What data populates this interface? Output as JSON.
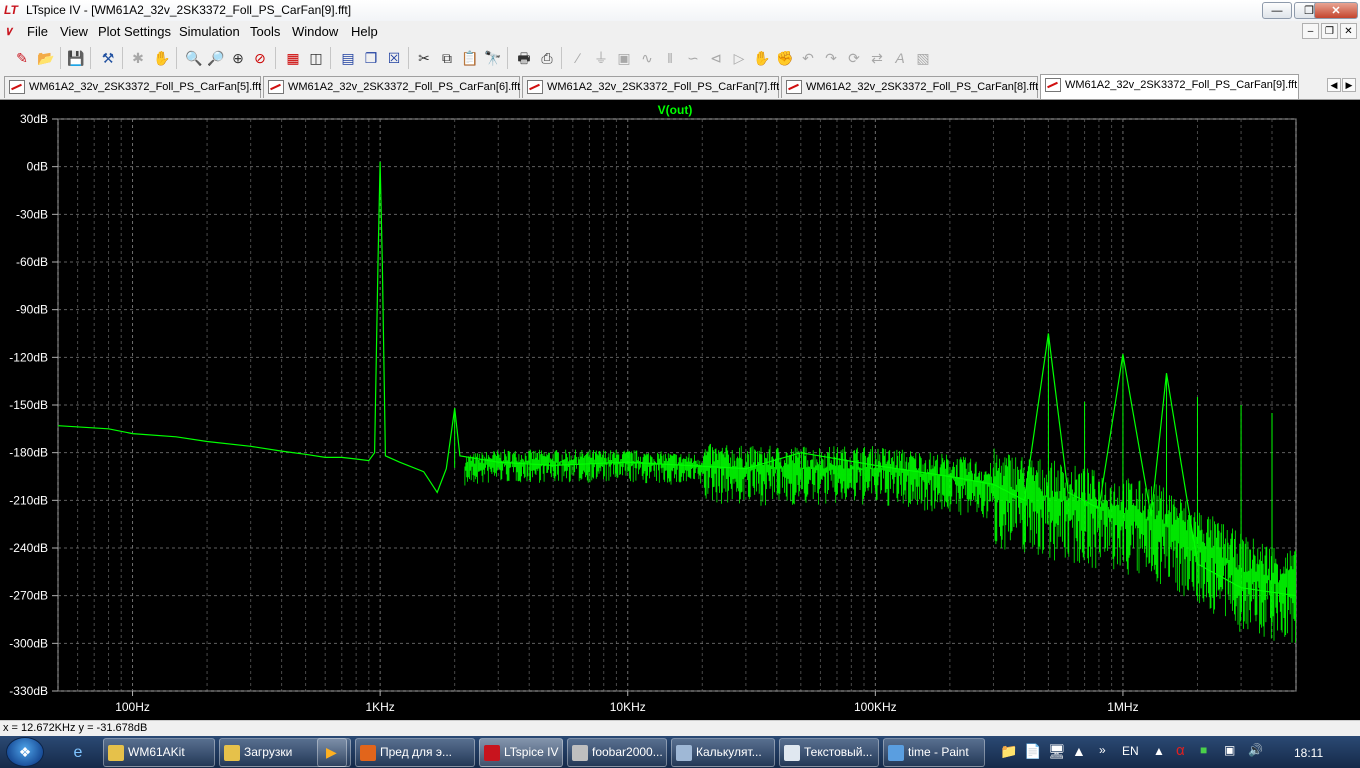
{
  "window": {
    "app_icon": "LT",
    "title": "LTspice IV - [WM61A2_32v_2SK3372_Foll_PS_CarFan[9].fft]",
    "buttons": [
      "minimize-icon",
      "restore-icon",
      "close-icon"
    ]
  },
  "menu": {
    "items": [
      "File",
      "View",
      "Plot Settings",
      "Simulation",
      "Tools",
      "Window",
      "Help"
    ]
  },
  "toolbar": {
    "icons": [
      "new-schematic-icon",
      "open-icon",
      "save-icon",
      "hammer-icon",
      "run-icon",
      "halt-icon",
      "zoom-in-icon",
      "zoom-out-icon",
      "zoom-fit-icon",
      "zoom-cancel-icon",
      "autorange-icon",
      "pick-visible-traces-icon",
      "tile-horizontal-icon",
      "cascade-icon",
      "close-all-icon",
      "cut-icon",
      "copy-icon",
      "paste-icon",
      "find-icon",
      "print-preview-icon",
      "print-icon",
      "wire-icon",
      "ground-icon",
      "label-icon",
      "resistor-icon",
      "capacitor-icon",
      "inductor-icon",
      "diode-icon",
      "component-icon",
      "move-icon",
      "drag-icon",
      "undo-icon",
      "redo-icon",
      "rotate-icon",
      "mirror-icon",
      "text-icon",
      "spice-directive-icon"
    ]
  },
  "tabs": [
    {
      "label": "WM61A2_32v_2SK3372_Foll_PS_CarFan[5].fft",
      "active": false
    },
    {
      "label": "WM61A2_32v_2SK3372_Foll_PS_CarFan[6].fft",
      "active": false
    },
    {
      "label": "WM61A2_32v_2SK3372_Foll_PS_CarFan[7].fft",
      "active": false
    },
    {
      "label": "WM61A2_32v_2SK3372_Foll_PS_CarFan[8].fft",
      "active": false
    },
    {
      "label": "WM61A2_32v_2SK3372_Foll_PS_CarFan[9].fft",
      "active": true
    }
  ],
  "chart_data": {
    "type": "line",
    "title": "",
    "xlabel": "",
    "ylabel": "",
    "x_scale": "log",
    "xlim": [
      50,
      5000000
    ],
    "ylim": [
      -330,
      30
    ],
    "grid": true,
    "grid_style": "dashed",
    "x_tick_labels": [
      "100Hz",
      "1KHz",
      "10KHz",
      "100KHz",
      "1MHz"
    ],
    "x_ticks": [
      100,
      1000,
      10000,
      100000,
      1000000
    ],
    "y_ticks": [
      30,
      0,
      -30,
      -60,
      -90,
      -120,
      -150,
      -180,
      -210,
      -240,
      -270,
      -300,
      -330
    ],
    "y_tick_labels": [
      "30dB",
      "0dB",
      "-30dB",
      "-60dB",
      "-90dB",
      "-120dB",
      "-150dB",
      "-180dB",
      "-210dB",
      "-240dB",
      "-270dB",
      "-300dB",
      "-330dB"
    ],
    "series": [
      {
        "name": "V(out)",
        "color": "#00ff00",
        "points": [
          [
            50,
            -163
          ],
          [
            80,
            -165
          ],
          [
            100,
            -168
          ],
          [
            150,
            -170
          ],
          [
            200,
            -173
          ],
          [
            300,
            -176
          ],
          [
            400,
            -179
          ],
          [
            500,
            -181
          ],
          [
            600,
            -183
          ],
          [
            700,
            -183
          ],
          [
            800,
            -184
          ],
          [
            900,
            -185
          ],
          [
            950,
            -180
          ],
          [
            980,
            -60
          ],
          [
            1000,
            3
          ],
          [
            1020,
            -60
          ],
          [
            1050,
            -182
          ],
          [
            1200,
            -186
          ],
          [
            1500,
            -192
          ],
          [
            1700,
            -205
          ],
          [
            1850,
            -190
          ],
          [
            2000,
            -152
          ],
          [
            2100,
            -182
          ],
          [
            3000,
            -186
          ],
          [
            5000,
            -188
          ],
          [
            10000,
            -186
          ],
          [
            30000,
            -190
          ],
          [
            50000,
            -180
          ],
          [
            100000,
            -188
          ],
          [
            200000,
            -195
          ],
          [
            300000,
            -200
          ],
          [
            400000,
            -210
          ],
          [
            500000,
            -105
          ],
          [
            600000,
            -205
          ],
          [
            800000,
            -215
          ],
          [
            1000000,
            -118
          ],
          [
            1300000,
            -220
          ],
          [
            1500000,
            -130
          ],
          [
            2000000,
            -250
          ],
          [
            3000000,
            -265
          ],
          [
            5000000,
            -270
          ]
        ]
      }
    ]
  },
  "status": {
    "cursor_readout": "x = 12.672KHz    y = -31.678dB"
  },
  "taskbar": {
    "start_icon": "windows-logo-icon",
    "quick_launch": [
      "ie-icon",
      "folder-icon",
      "media-player-icon"
    ],
    "tasks": [
      {
        "label": "WM61AKit",
        "icon_color": "#e6c14a",
        "active": false
      },
      {
        "label": "Загрузки",
        "icon_color": "#e6c14a",
        "active": false
      },
      {
        "label": "Пред для э...",
        "icon_color": "#e2651b",
        "active": false
      },
      {
        "label": "LTspice IV ...",
        "icon_color": "#c8141e",
        "active": true
      },
      {
        "label": "foobar2000...",
        "icon_color": "#bfbfbf",
        "active": false
      },
      {
        "label": "Калькулят...",
        "icon_color": "#9fb8d6",
        "active": false
      },
      {
        "label": "Текстовый...",
        "icon_color": "#e0e8f0",
        "active": false
      },
      {
        "label": "time - Paint",
        "icon_color": "#5a9ee0",
        "active": false
      }
    ],
    "language": "EN",
    "clock": "18:11"
  }
}
